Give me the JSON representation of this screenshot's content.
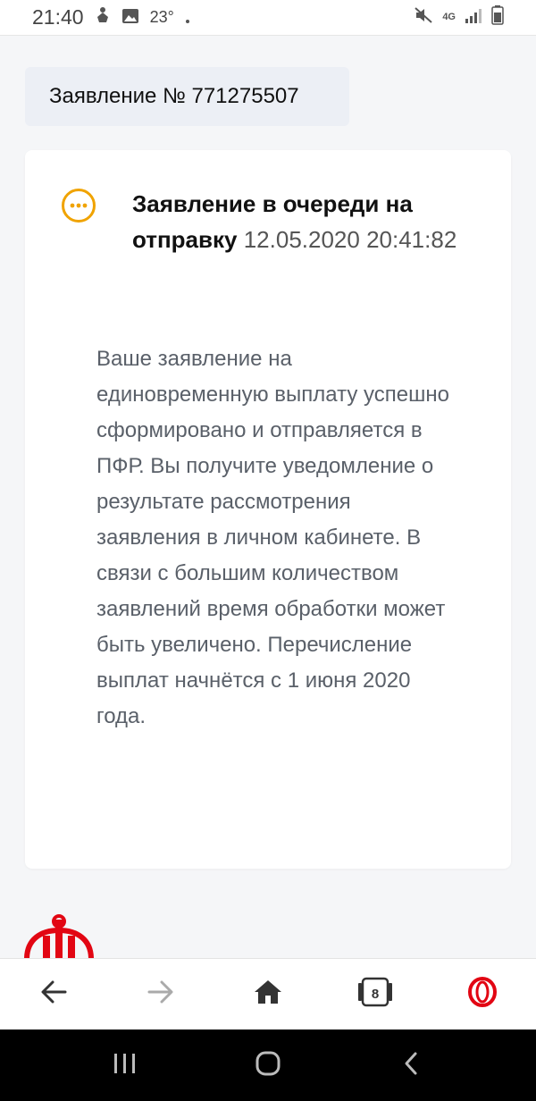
{
  "status_bar": {
    "time": "21:40",
    "temperature": "23°",
    "network": "4G"
  },
  "application": {
    "number_label": "Заявление № 771275507"
  },
  "card": {
    "title": "Заявление в очереди на отправку",
    "timestamp": "12.05.2020 20:41:82",
    "text": "Ваше заявление на единовременную выплату успешно сформировано и отправляется в ПФР. Вы получите уведомление о результате рассмотрения заявления в личном кабинете. В связи с большим количеством заявлений время обработки может быть увеличено. Перечисление выплат начнётся с 1 июня 2020 года.",
    "status_color": "#f0a300"
  },
  "browser": {
    "tabs_count": "8",
    "opera_color": "#e20613"
  },
  "icons": {
    "status": "clock-dots-icon",
    "back": "arrow-left-icon",
    "forward": "arrow-right-icon",
    "home": "home-icon",
    "tabs": "tabs-icon",
    "opera": "opera-icon"
  }
}
